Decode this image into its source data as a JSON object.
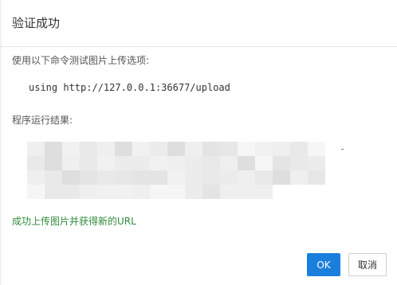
{
  "dialog": {
    "title": "验证成功",
    "instruction": "使用以下命令测试图片上传选项:",
    "command": "using http://127.0.0.1:36677/upload",
    "result_label": "程序运行结果:",
    "result_tail": "-",
    "success_message": "成功上传图片并获得新的URL",
    "ok_label": "OK",
    "cancel_label": "取消"
  },
  "colors": {
    "ok_button": "#1a7fdc",
    "success_text": "#2e8b3a"
  }
}
